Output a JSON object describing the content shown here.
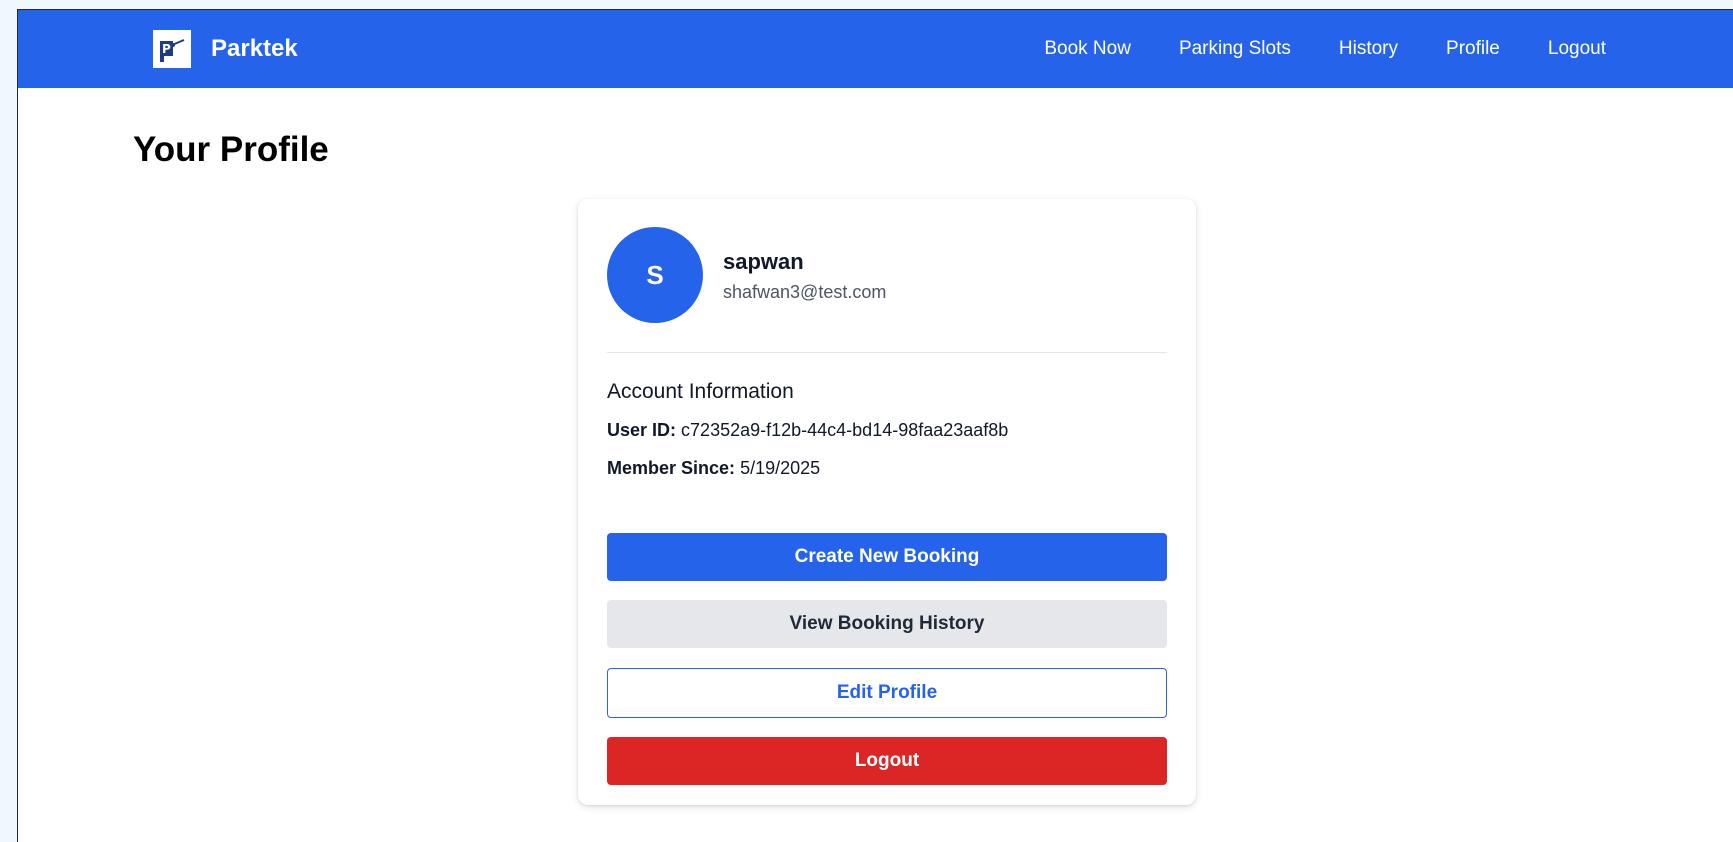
{
  "navbar": {
    "brand": "Parktek",
    "logo_icon": "parking-gate-icon",
    "links": [
      {
        "label": "Book Now"
      },
      {
        "label": "Parking Slots"
      },
      {
        "label": "History"
      },
      {
        "label": "Profile"
      },
      {
        "label": "Logout"
      }
    ]
  },
  "page": {
    "title": "Your Profile"
  },
  "profile": {
    "avatar_initial": "S",
    "name": "sapwan",
    "email": "shafwan3@test.com",
    "section_title": "Account Information",
    "user_id_label": "User ID:",
    "user_id": "c72352a9-f12b-44c4-bd14-98faa23aaf8b",
    "member_since_label": "Member Since:",
    "member_since": "5/19/2025"
  },
  "actions": {
    "create_booking": "Create New Booking",
    "view_history": "View Booking History",
    "edit_profile": "Edit Profile",
    "logout": "Logout"
  },
  "colors": {
    "primary": "#2563eb",
    "secondary": "#e5e7eb",
    "danger": "#dc2626",
    "background": "#eef8fd"
  }
}
